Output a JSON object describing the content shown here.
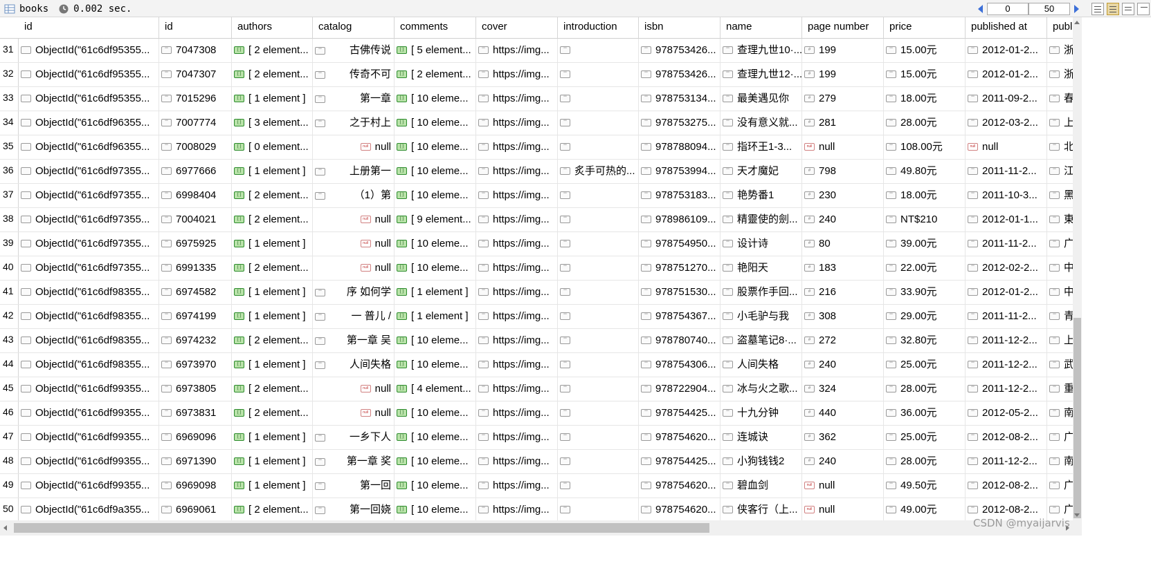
{
  "toolbar": {
    "collection_name": "books",
    "query_time": "0.002 sec.",
    "skip_value": "0",
    "limit_value": "50"
  },
  "columns": [
    "id",
    "id",
    "authors",
    "catalog",
    "comments",
    "cover",
    "introduction",
    "isbn",
    "name",
    "page number",
    "price",
    "published at",
    "publ"
  ],
  "rows": [
    {
      "n": "31",
      "oid": "ObjectId(\"61c6df95355...",
      "id": "7047308",
      "authors": "[ 2 element...",
      "catalog": "古佛传说",
      "comments": "[ 5 element...",
      "cover": "https://img...",
      "intro": "",
      "isbn": "978753426...",
      "name": "查理九世10·...",
      "page": "199",
      "price": "15.00元",
      "pub": "2012-01-2...",
      "publ": "浙"
    },
    {
      "n": "32",
      "oid": "ObjectId(\"61c6df95355...",
      "id": "7047307",
      "authors": "[ 2 element...",
      "catalog": "传奇不可",
      "comments": "[ 2 element...",
      "cover": "https://img...",
      "intro": "",
      "isbn": "978753426...",
      "name": "查理九世12·...",
      "page": "199",
      "price": "15.00元",
      "pub": "2012-01-2...",
      "publ": "浙"
    },
    {
      "n": "33",
      "oid": "ObjectId(\"61c6df95355...",
      "id": "7015296",
      "authors": "[ 1 element ]",
      "catalog": "第一章",
      "comments": "[ 10 eleme...",
      "cover": "https://img...",
      "intro": "",
      "isbn": "978753134...",
      "name": "最美遇见你",
      "page": "279",
      "price": "18.00元",
      "pub": "2011-09-2...",
      "publ": "春"
    },
    {
      "n": "34",
      "oid": "ObjectId(\"61c6df96355...",
      "id": "7007774",
      "authors": "[ 3 element...",
      "catalog": "之于村上",
      "comments": "[ 10 eleme...",
      "cover": "https://img...",
      "intro": "",
      "isbn": "978753275...",
      "name": "没有意义就...",
      "page": "281",
      "price": "28.00元",
      "pub": "2012-03-2...",
      "publ": "上"
    },
    {
      "n": "35",
      "oid": "ObjectId(\"61c6df96355...",
      "id": "7008029",
      "authors": "[ 0 element...",
      "catalog": null,
      "comments": "[ 10 eleme...",
      "cover": "https://img...",
      "intro": "",
      "isbn": "978788094...",
      "name": "指环王1-3...",
      "page": null,
      "price": "108.00元",
      "pub": null,
      "publ": "北"
    },
    {
      "n": "36",
      "oid": "ObjectId(\"61c6df97355...",
      "id": "6977666",
      "authors": "[ 1 element ]",
      "catalog": "上册第一",
      "comments": "[ 10 eleme...",
      "cover": "https://img...",
      "intro": "炙手可热的...",
      "isbn": "978753994...",
      "name": "天才魔妃",
      "page": "798",
      "price": "49.80元",
      "pub": "2011-11-2...",
      "publ": "江"
    },
    {
      "n": "37",
      "oid": "ObjectId(\"61c6df97355...",
      "id": "6998404",
      "authors": "[ 2 element...",
      "catalog": "（1）第",
      "comments": "[ 10 eleme...",
      "cover": "https://img...",
      "intro": "",
      "isbn": "978753183...",
      "name": "艳势番1",
      "page": "230",
      "price": "18.00元",
      "pub": "2011-10-3...",
      "publ": "黑"
    },
    {
      "n": "38",
      "oid": "ObjectId(\"61c6df97355...",
      "id": "7004021",
      "authors": "[ 2 element...",
      "catalog": null,
      "comments": "[ 9 element...",
      "cover": "https://img...",
      "intro": "",
      "isbn": "978986109...",
      "name": "精靈使的劍...",
      "page": "240",
      "price": "NT$210",
      "pub": "2012-01-1...",
      "publ": "東"
    },
    {
      "n": "39",
      "oid": "ObjectId(\"61c6df97355...",
      "id": "6975925",
      "authors": "[ 1 element ]",
      "catalog": null,
      "comments": "[ 10 eleme...",
      "cover": "https://img...",
      "intro": "",
      "isbn": "978754950...",
      "name": "设计诗",
      "page": "80",
      "price": "39.00元",
      "pub": "2011-11-2...",
      "publ": "广"
    },
    {
      "n": "40",
      "oid": "ObjectId(\"61c6df97355...",
      "id": "6991335",
      "authors": "[ 2 element...",
      "catalog": null,
      "comments": "[ 10 eleme...",
      "cover": "https://img...",
      "intro": "",
      "isbn": "978751270...",
      "name": "艳阳天",
      "page": "183",
      "price": "22.00元",
      "pub": "2012-02-2...",
      "publ": "中"
    },
    {
      "n": "41",
      "oid": "ObjectId(\"61c6df98355...",
      "id": "6974582",
      "authors": "[ 1 element ]",
      "catalog": "序 如何学",
      "comments": "[ 1 element ]",
      "cover": "https://img...",
      "intro": "",
      "isbn": "978751530...",
      "name": "股票作手回...",
      "page": "216",
      "price": "33.90元",
      "pub": "2012-01-2...",
      "publ": "中"
    },
    {
      "n": "42",
      "oid": "ObjectId(\"61c6df98355...",
      "id": "6974199",
      "authors": "[ 1 element ]",
      "catalog": "一 普儿 /",
      "comments": "[ 1 element ]",
      "cover": "https://img...",
      "intro": "",
      "isbn": "978754367...",
      "name": "小毛驴与我",
      "page": "308",
      "price": "29.00元",
      "pub": "2011-11-2...",
      "publ": "青"
    },
    {
      "n": "43",
      "oid": "ObjectId(\"61c6df98355...",
      "id": "6974232",
      "authors": "[ 2 element...",
      "catalog": "第一章 吴",
      "comments": "[ 10 eleme...",
      "cover": "https://img...",
      "intro": "",
      "isbn": "978780740...",
      "name": "盗墓笔记8·...",
      "page": "272",
      "price": "32.80元",
      "pub": "2011-12-2...",
      "publ": "上"
    },
    {
      "n": "44",
      "oid": "ObjectId(\"61c6df98355...",
      "id": "6973970",
      "authors": "[ 1 element ]",
      "catalog": "人间失格",
      "comments": "[ 10 eleme...",
      "cover": "https://img...",
      "intro": "",
      "isbn": "978754306...",
      "name": "人间失格",
      "page": "240",
      "price": "25.00元",
      "pub": "2011-12-2...",
      "publ": "武"
    },
    {
      "n": "45",
      "oid": "ObjectId(\"61c6df99355...",
      "id": "6973805",
      "authors": "[ 2 element...",
      "catalog": null,
      "comments": "[ 4 element...",
      "cover": "https://img...",
      "intro": "",
      "isbn": "978722904...",
      "name": "冰与火之歌...",
      "page": "324",
      "price": "28.00元",
      "pub": "2011-12-2...",
      "publ": "重"
    },
    {
      "n": "46",
      "oid": "ObjectId(\"61c6df99355...",
      "id": "6973831",
      "authors": "[ 2 element...",
      "catalog": null,
      "comments": "[ 10 eleme...",
      "cover": "https://img...",
      "intro": "",
      "isbn": "978754425...",
      "name": "十九分钟",
      "page": "440",
      "price": "36.00元",
      "pub": "2012-05-2...",
      "publ": "南"
    },
    {
      "n": "47",
      "oid": "ObjectId(\"61c6df99355...",
      "id": "6969096",
      "authors": "[ 1 element ]",
      "catalog": "一乡下人",
      "comments": "[ 10 eleme...",
      "cover": "https://img...",
      "intro": "",
      "isbn": "978754620...",
      "name": "连城诀",
      "page": "362",
      "price": "25.00元",
      "pub": "2012-08-2...",
      "publ": "广"
    },
    {
      "n": "48",
      "oid": "ObjectId(\"61c6df99355...",
      "id": "6971390",
      "authors": "[ 1 element ]",
      "catalog": "第一章 奖",
      "comments": "[ 10 eleme...",
      "cover": "https://img...",
      "intro": "",
      "isbn": "978754425...",
      "name": "小狗钱钱2",
      "page": "240",
      "price": "28.00元",
      "pub": "2011-12-2...",
      "publ": "南"
    },
    {
      "n": "49",
      "oid": "ObjectId(\"61c6df99355...",
      "id": "6969098",
      "authors": "[ 1 element ]",
      "catalog": "第一回",
      "comments": "[ 10 eleme...",
      "cover": "https://img...",
      "intro": "",
      "isbn": "978754620...",
      "name": "碧血剑",
      "page": null,
      "price": "49.50元",
      "pub": "2012-08-2...",
      "publ": "广"
    },
    {
      "n": "50",
      "oid": "ObjectId(\"61c6df9a355...",
      "id": "6969061",
      "authors": "[ 2 element...",
      "catalog": "第一回娆",
      "comments": "[ 10 eleme...",
      "cover": "https://img...",
      "intro": "",
      "isbn": "978754620...",
      "name": "侠客行（上...",
      "page": null,
      "price": "49.00元",
      "pub": "2012-08-2...",
      "publ": "广"
    }
  ],
  "null_text": "null",
  "watermark": "CSDN @myaijarvis",
  "colors": {
    "array_badge": "#b9e3a9",
    "null_badge": "#c03030",
    "pager_arrow": "#3c6fd8"
  }
}
